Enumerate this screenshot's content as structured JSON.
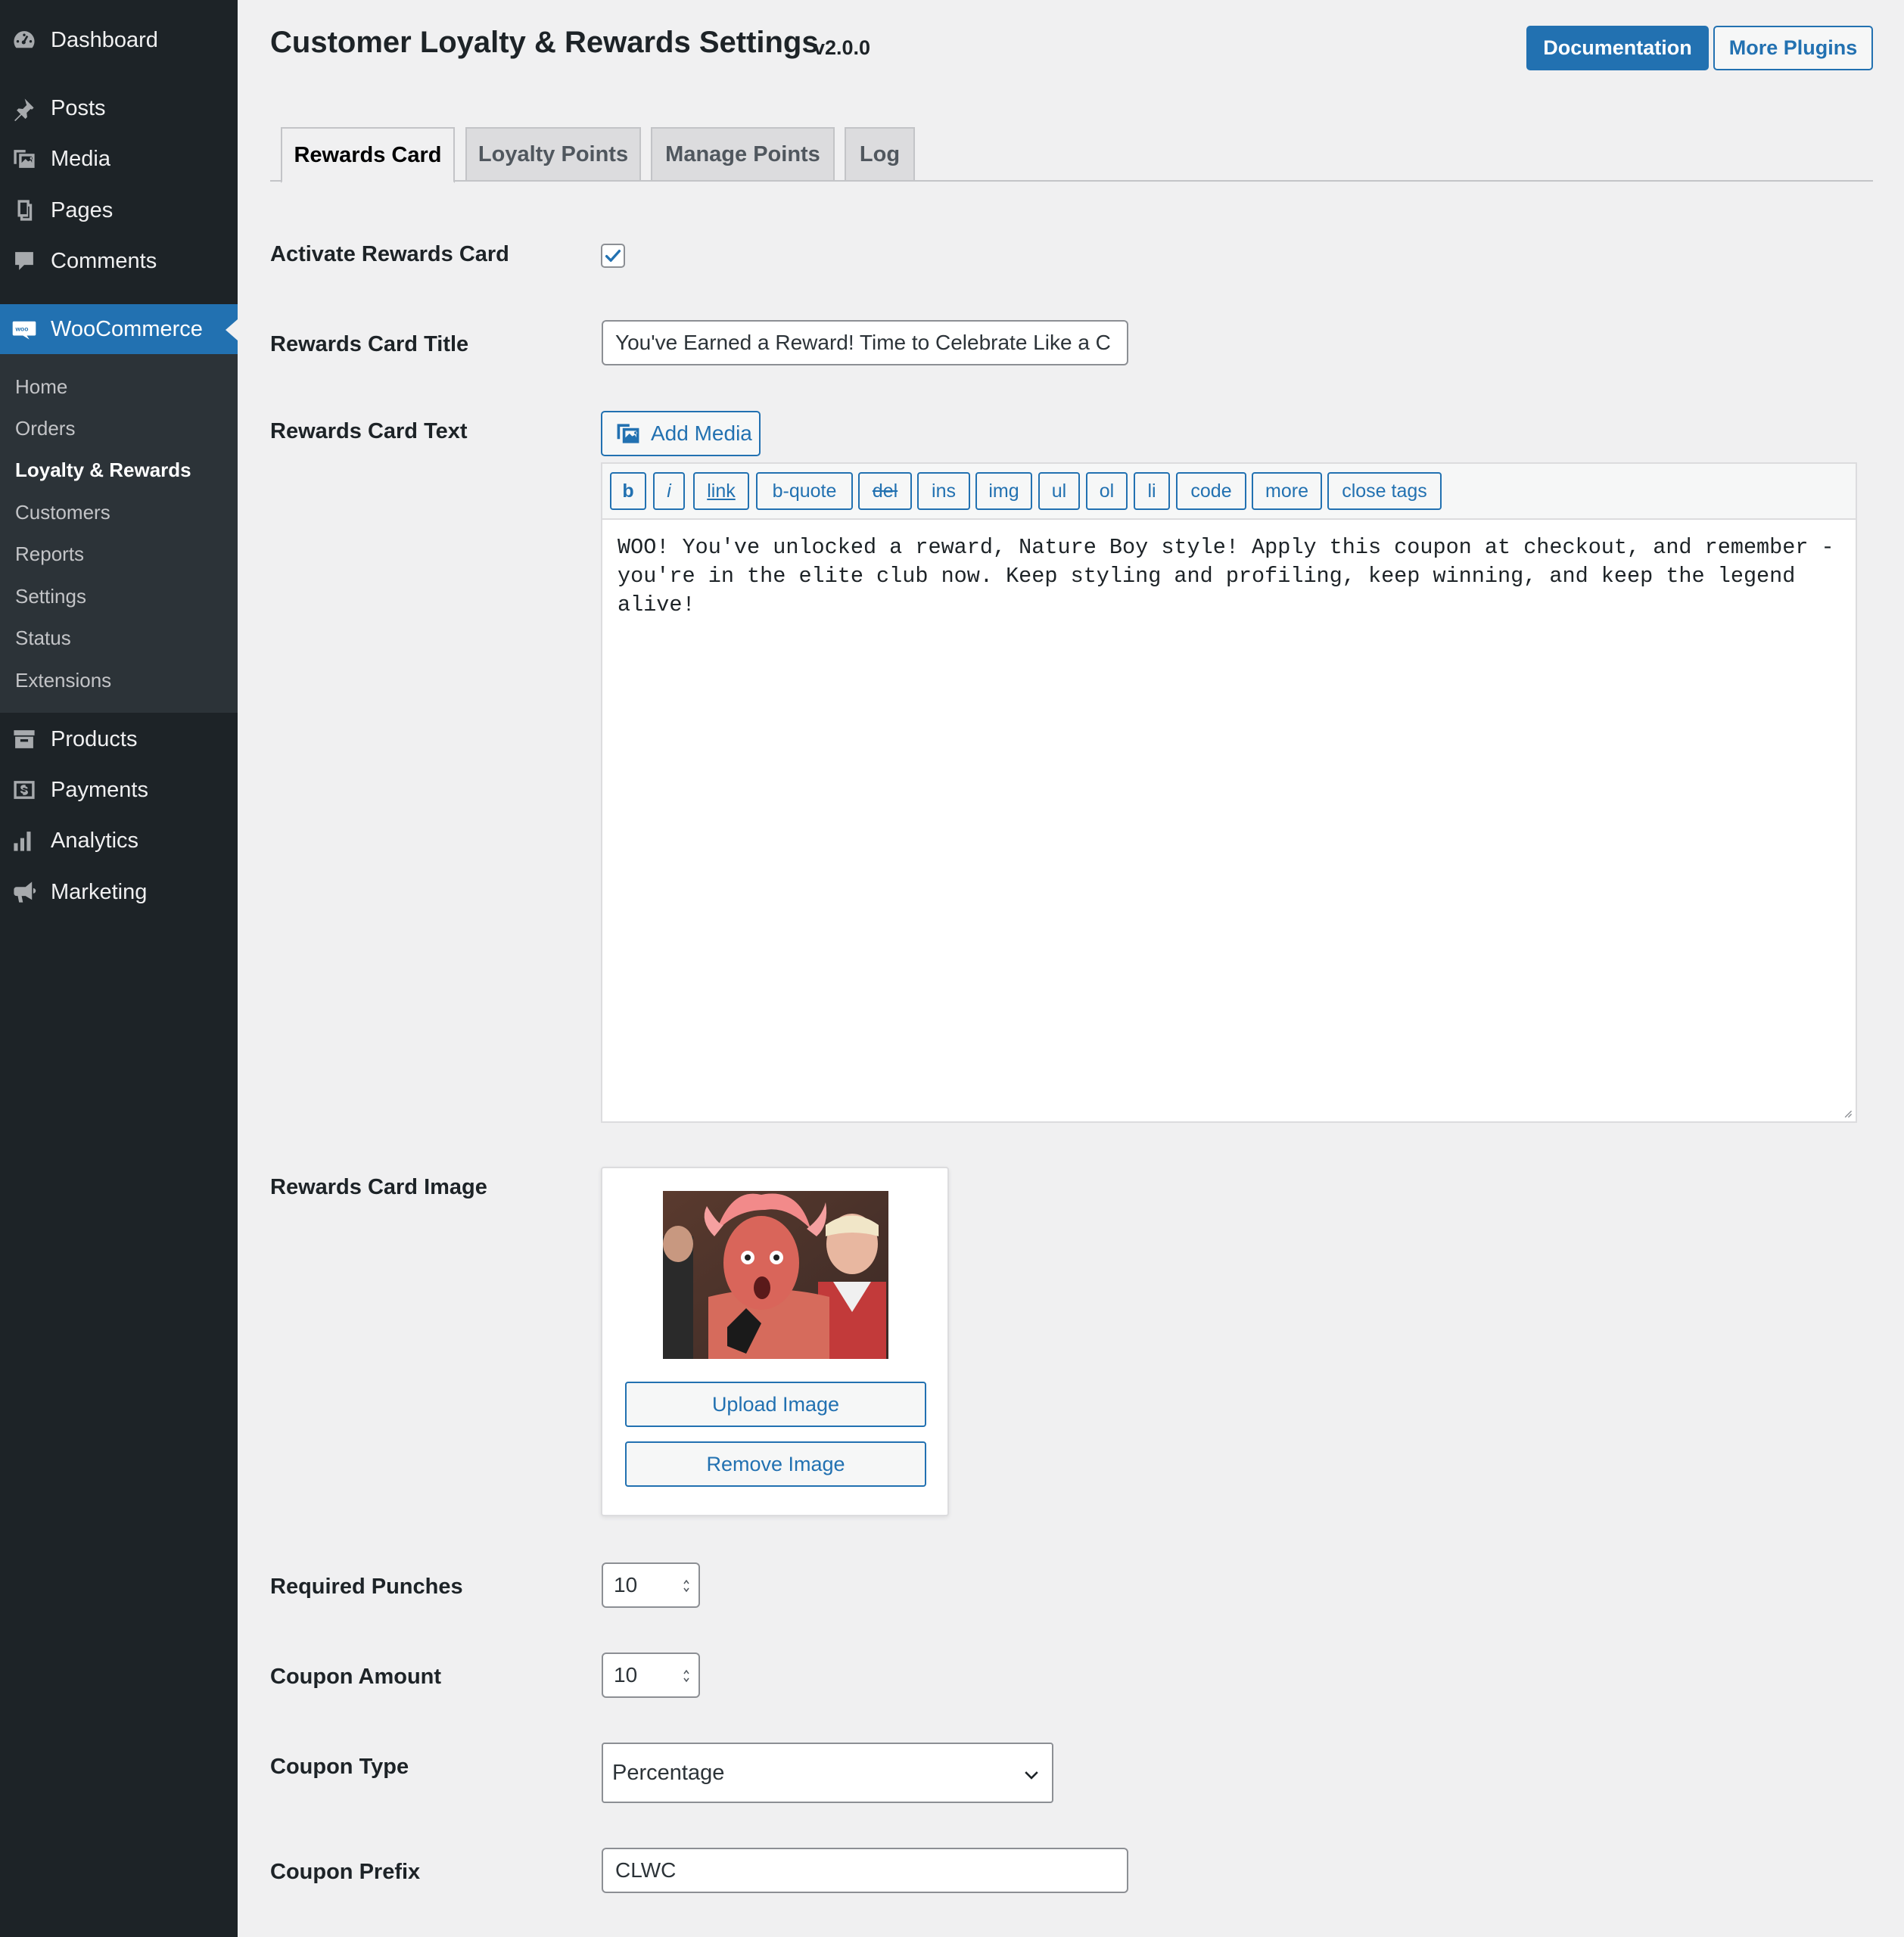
{
  "sidebar": {
    "items": [
      {
        "label": "Dashboard",
        "icon": "dashboard-icon"
      },
      {
        "label": "Posts",
        "icon": "pushpin-icon"
      },
      {
        "label": "Media",
        "icon": "media-icon"
      },
      {
        "label": "Pages",
        "icon": "pages-icon"
      },
      {
        "label": "Comments",
        "icon": "comment-icon"
      },
      {
        "label": "WooCommerce",
        "icon": "woo-icon"
      },
      {
        "label": "Products",
        "icon": "archive-icon"
      },
      {
        "label": "Payments",
        "icon": "payments-icon"
      },
      {
        "label": "Analytics",
        "icon": "bar-chart-icon"
      },
      {
        "label": "Marketing",
        "icon": "megaphone-icon"
      }
    ],
    "woo_submenu": [
      "Home",
      "Orders",
      "Loyalty & Rewards",
      "Customers",
      "Reports",
      "Settings",
      "Status",
      "Extensions"
    ],
    "current_submenu": "Loyalty & Rewards"
  },
  "header": {
    "title": "Customer Loyalty & Rewards Settings",
    "version": "v2.0.0",
    "documentation_label": "Documentation",
    "more_plugins_label": "More Plugins"
  },
  "tabs": [
    {
      "label": "Rewards Card",
      "active": true
    },
    {
      "label": "Loyalty Points",
      "active": false
    },
    {
      "label": "Manage Points",
      "active": false
    },
    {
      "label": "Log",
      "active": false
    }
  ],
  "form": {
    "activate_label": "Activate Rewards Card",
    "activate_checked": true,
    "title_label": "Rewards Card Title",
    "title_value": "You've Earned a Reward! Time to Celebrate Like a C",
    "text_label": "Rewards Card Text",
    "add_media_label": "Add Media",
    "quicktags": [
      "b",
      "i",
      "link",
      "b-quote",
      "del",
      "ins",
      "img",
      "ul",
      "ol",
      "li",
      "code",
      "more",
      "close tags"
    ],
    "text_value": "WOO! You've unlocked a reward, Nature Boy style! Apply this coupon at checkout, and remember - you're in the elite club now. Keep styling and profiling, keep winning, and keep the legend alive!",
    "image_label": "Rewards Card Image",
    "upload_label": "Upload Image",
    "remove_label": "Remove Image",
    "punches_label": "Required Punches",
    "punches_value": "10",
    "amount_label": "Coupon Amount",
    "amount_value": "10",
    "type_label": "Coupon Type",
    "type_value": "Percentage",
    "prefix_label": "Coupon Prefix",
    "prefix_value": "CLWC"
  },
  "colors": {
    "accent": "#2271b1",
    "sidebar_bg": "#1d2327",
    "submenu_bg": "#2c3338",
    "page_bg": "#f0f0f1"
  }
}
